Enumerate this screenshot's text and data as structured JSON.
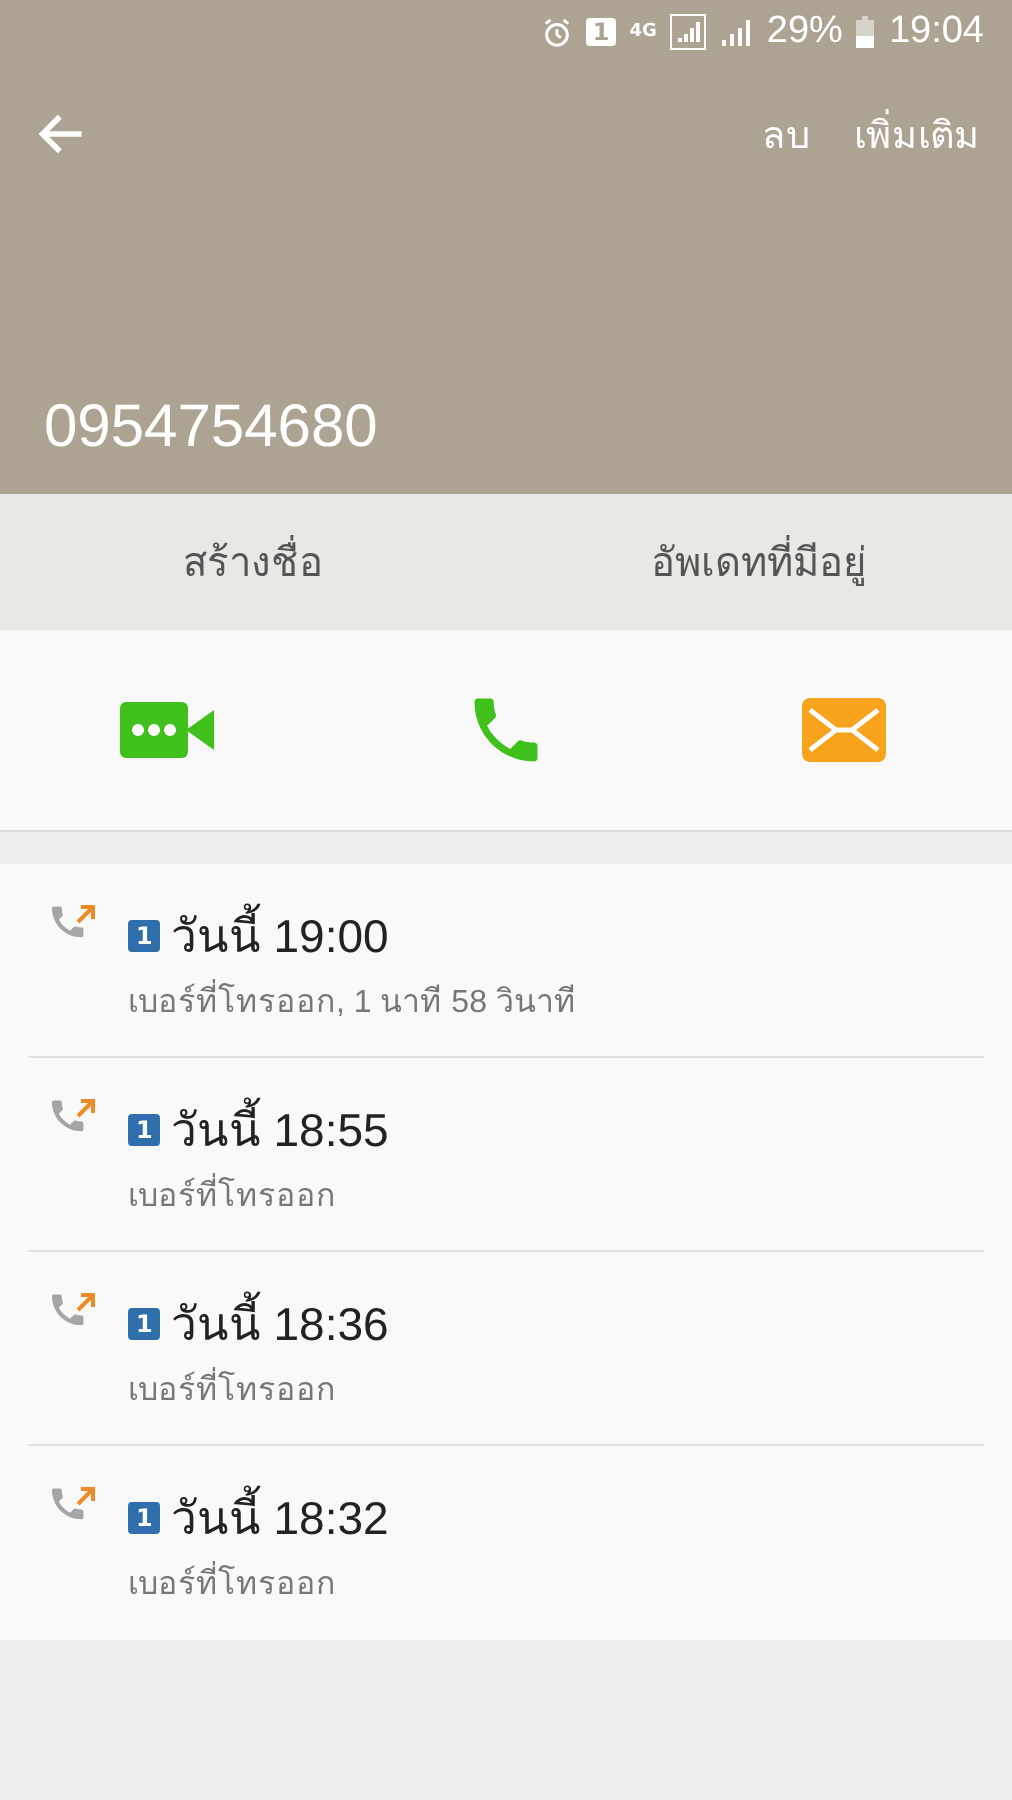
{
  "status_bar": {
    "sim": "1",
    "network": "4G",
    "battery": "29%",
    "time": "19:04"
  },
  "header": {
    "actions": [
      "ลบ",
      "เพิ่มเติม"
    ],
    "number": "0954754680"
  },
  "contact_buttons": [
    "สร้างชื่อ",
    "อัพเดทที่มีอยู่"
  ],
  "quick_actions": [
    {
      "kind": "video"
    },
    {
      "kind": "call"
    },
    {
      "kind": "message"
    }
  ],
  "calls": [
    {
      "sim": "1",
      "time": "วันนี้ 19:00",
      "detail": "เบอร์ที่โทรออก, 1 นาที 58 วินาที"
    },
    {
      "sim": "1",
      "time": "วันนี้ 18:55",
      "detail": "เบอร์ที่โทรออก"
    },
    {
      "sim": "1",
      "time": "วันนี้ 18:36",
      "detail": "เบอร์ที่โทรออก"
    },
    {
      "sim": "1",
      "time": "วันนี้ 18:32",
      "detail": "เบอร์ที่โทรออก"
    }
  ]
}
